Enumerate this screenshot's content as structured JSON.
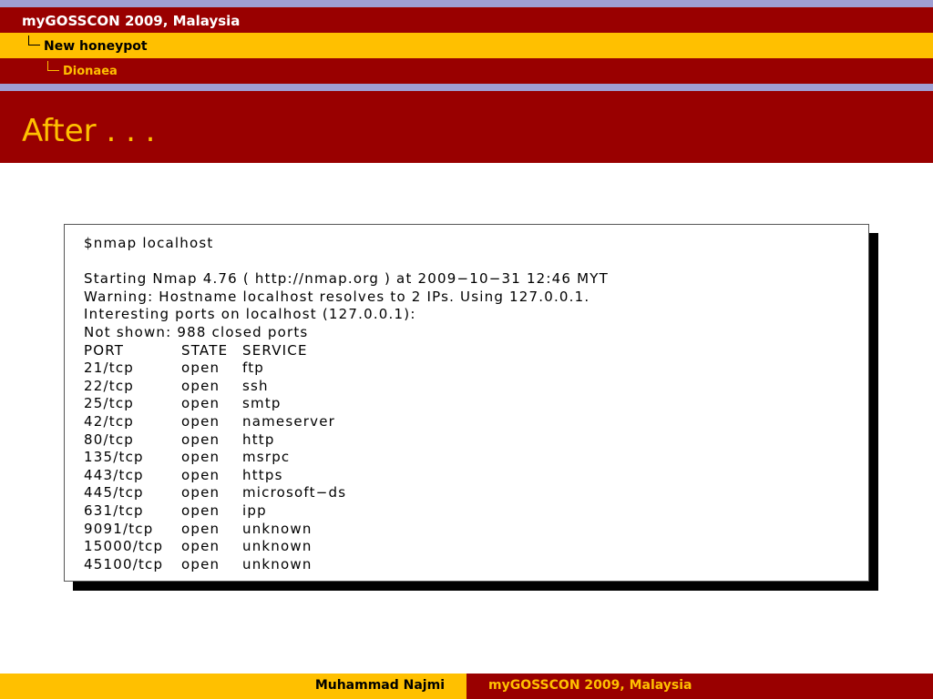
{
  "header": {
    "section": "myGOSSCON 2009, Malaysia",
    "subsection": "New honeypot",
    "subsubsection": "Dionaea"
  },
  "slide": {
    "title": "After . . ."
  },
  "terminal": {
    "lines": [
      "$nmap localhost",
      "",
      "Starting Nmap 4.76 ( http://nmap.org ) at 2009−10−31 12:46 MYT",
      "Warning: Hostname localhost resolves to 2 IPs. Using 127.0.0.1.",
      "Interesting ports on localhost (127.0.0.1):",
      "Not shown: 988 closed ports"
    ],
    "table_headers": [
      "PORT",
      "STATE",
      "SERVICE"
    ],
    "rows": [
      [
        "21/tcp",
        "open",
        "ftp"
      ],
      [
        "22/tcp",
        "open",
        "ssh"
      ],
      [
        "25/tcp",
        "open",
        "smtp"
      ],
      [
        "42/tcp",
        "open",
        "nameserver"
      ],
      [
        "80/tcp",
        "open",
        "http"
      ],
      [
        "135/tcp",
        "open",
        "msrpc"
      ],
      [
        "443/tcp",
        "open",
        "https"
      ],
      [
        "445/tcp",
        "open",
        "microsoft−ds"
      ],
      [
        "631/tcp",
        "open",
        "ipp"
      ],
      [
        "9091/tcp",
        "open",
        "unknown"
      ],
      [
        "15000/tcp",
        "open",
        "unknown"
      ],
      [
        "45100/tcp",
        "open",
        "unknown"
      ]
    ]
  },
  "footer": {
    "author": "Muhammad Najmi",
    "event": "myGOSSCON 2009, Malaysia"
  },
  "colors": {
    "dark_red": "#990000",
    "gold": "#ffc000",
    "lavender": "#9f9fd3"
  }
}
